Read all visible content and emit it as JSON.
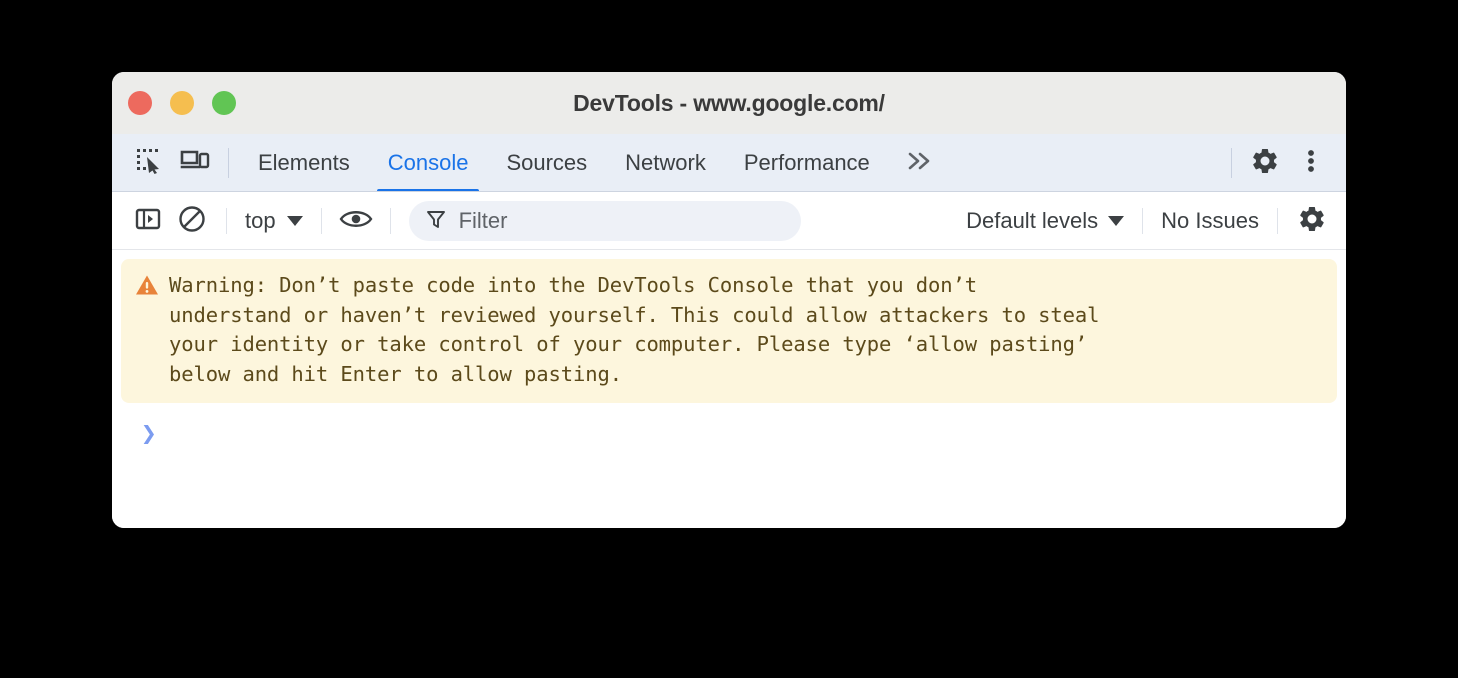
{
  "window": {
    "title": "DevTools - www.google.com/",
    "traffic_lights": [
      {
        "name": "close",
        "color": "#ed6a5e"
      },
      {
        "name": "minimize",
        "color": "#f5be4f"
      },
      {
        "name": "maximize",
        "color": "#61c554"
      }
    ]
  },
  "tabbar": {
    "left_icons": [
      {
        "name": "inspect-element-icon",
        "label": "Inspect element"
      },
      {
        "name": "device-toolbar-icon",
        "label": "Toggle device toolbar"
      }
    ],
    "tabs": [
      {
        "label": "Elements",
        "active": false
      },
      {
        "label": "Console",
        "active": true
      },
      {
        "label": "Sources",
        "active": false
      },
      {
        "label": "Network",
        "active": false
      },
      {
        "label": "Performance",
        "active": false
      }
    ],
    "overflow_label": "»",
    "right_icons": [
      {
        "name": "settings-gear-icon",
        "label": "Settings"
      },
      {
        "name": "more-options-icon",
        "label": "Customize and control DevTools"
      }
    ],
    "accent_color": "#1a73e8",
    "background_color": "#e9eef6"
  },
  "console_toolbar": {
    "sidebar_toggle_label": "Show console sidebar",
    "clear_console_label": "Clear console",
    "context": {
      "value": "top",
      "options": [
        "top"
      ]
    },
    "eye_label": "Create live expression",
    "filter": {
      "value": "",
      "placeholder": "Filter",
      "icon": "filter-funnel-icon"
    },
    "levels": {
      "value": "Default levels",
      "options": [
        "Default levels"
      ]
    },
    "issues_label": "No Issues",
    "settings_label": "Console settings"
  },
  "console": {
    "warning": {
      "icon": "warning-triangle-icon",
      "icon_color": "#e8833a",
      "background_color": "#fdf6dd",
      "text_color": "#5c4a1b",
      "text": "Warning: Don’t paste code into the DevTools Console that you don’t\nunderstand or haven’t reviewed yourself. This could allow attackers to steal\nyour identity or take control of your computer. Please type ‘allow pasting’\nbelow and hit Enter to allow pasting."
    },
    "prompt": {
      "chevron": "❯",
      "value": "",
      "chevron_color": "#7c9cf0"
    }
  }
}
